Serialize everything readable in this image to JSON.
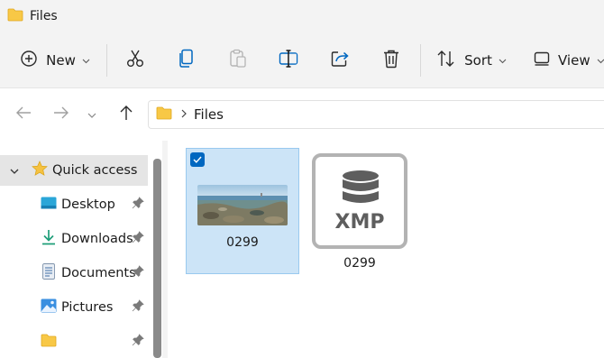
{
  "window": {
    "title": "Files"
  },
  "toolbar": {
    "new_label": "New",
    "sort_label": "Sort",
    "view_label": "View"
  },
  "address": {
    "crumbs": [
      "Files"
    ]
  },
  "sidebar": {
    "items": [
      {
        "label": "Quick access"
      },
      {
        "label": "Desktop"
      },
      {
        "label": "Downloads"
      },
      {
        "label": "Documents"
      },
      {
        "label": "Pictures"
      },
      {
        "label": ""
      }
    ]
  },
  "files": [
    {
      "name": "0299",
      "kind": "image",
      "selected": true
    },
    {
      "name": "0299",
      "kind": "xmp",
      "icon_text": "XMP",
      "selected": false
    }
  ],
  "colors": {
    "accent": "#0067c0",
    "selection": "#cce4f7",
    "folder": "#f8c846"
  }
}
